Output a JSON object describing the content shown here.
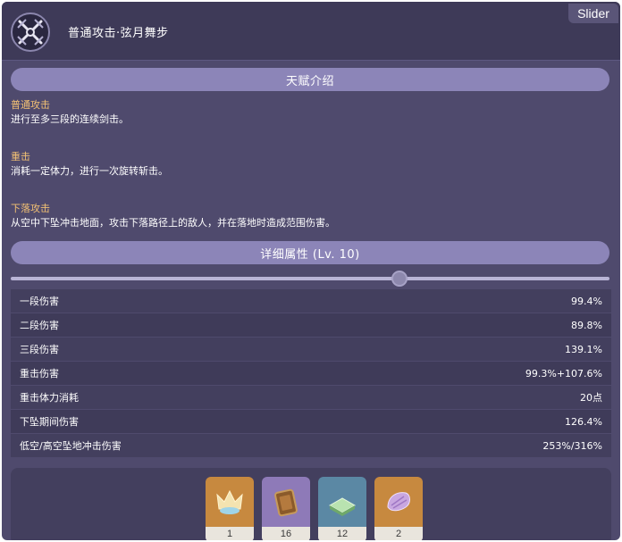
{
  "header": {
    "title": "普通攻击·弦月舞步",
    "icon": "crossed-swords-icon",
    "slider_tag": "Slider"
  },
  "intro_bar": "天赋介绍",
  "descriptions": [
    {
      "title": "普通攻击",
      "text": "进行至多三段的连续剑击。"
    },
    {
      "title": "重击",
      "text": "消耗一定体力，进行一次旋转斩击。"
    },
    {
      "title": "下落攻击",
      "text": "从空中下坠冲击地面，攻击下落路径上的敌人，并在落地时造成范围伤害。"
    }
  ],
  "detail_bar": "详细属性 (Lv. 10)",
  "level_slider": {
    "level": 10,
    "max_level": 15
  },
  "stats": [
    {
      "label": "一段伤害",
      "value": "99.4%"
    },
    {
      "label": "二段伤害",
      "value": "89.8%"
    },
    {
      "label": "三段伤害",
      "value": "139.1%"
    },
    {
      "label": "重击伤害",
      "value": "99.3%+107.6%"
    },
    {
      "label": "重击体力消耗",
      "value": "20点"
    },
    {
      "label": "下坠期间伤害",
      "value": "126.4%"
    },
    {
      "label": "低空/高空坠地冲击伤害",
      "value": "253%/316%"
    }
  ],
  "materials": [
    {
      "icon": "crown-icon",
      "count": "1",
      "color": "#c7893f"
    },
    {
      "icon": "scroll-book-icon",
      "count": "16",
      "color": "#8e7ab8"
    },
    {
      "icon": "green-book-icon",
      "count": "12",
      "color": "#5b88a4"
    },
    {
      "icon": "purple-shell-icon",
      "count": "2",
      "color": "#c7893f"
    }
  ]
}
